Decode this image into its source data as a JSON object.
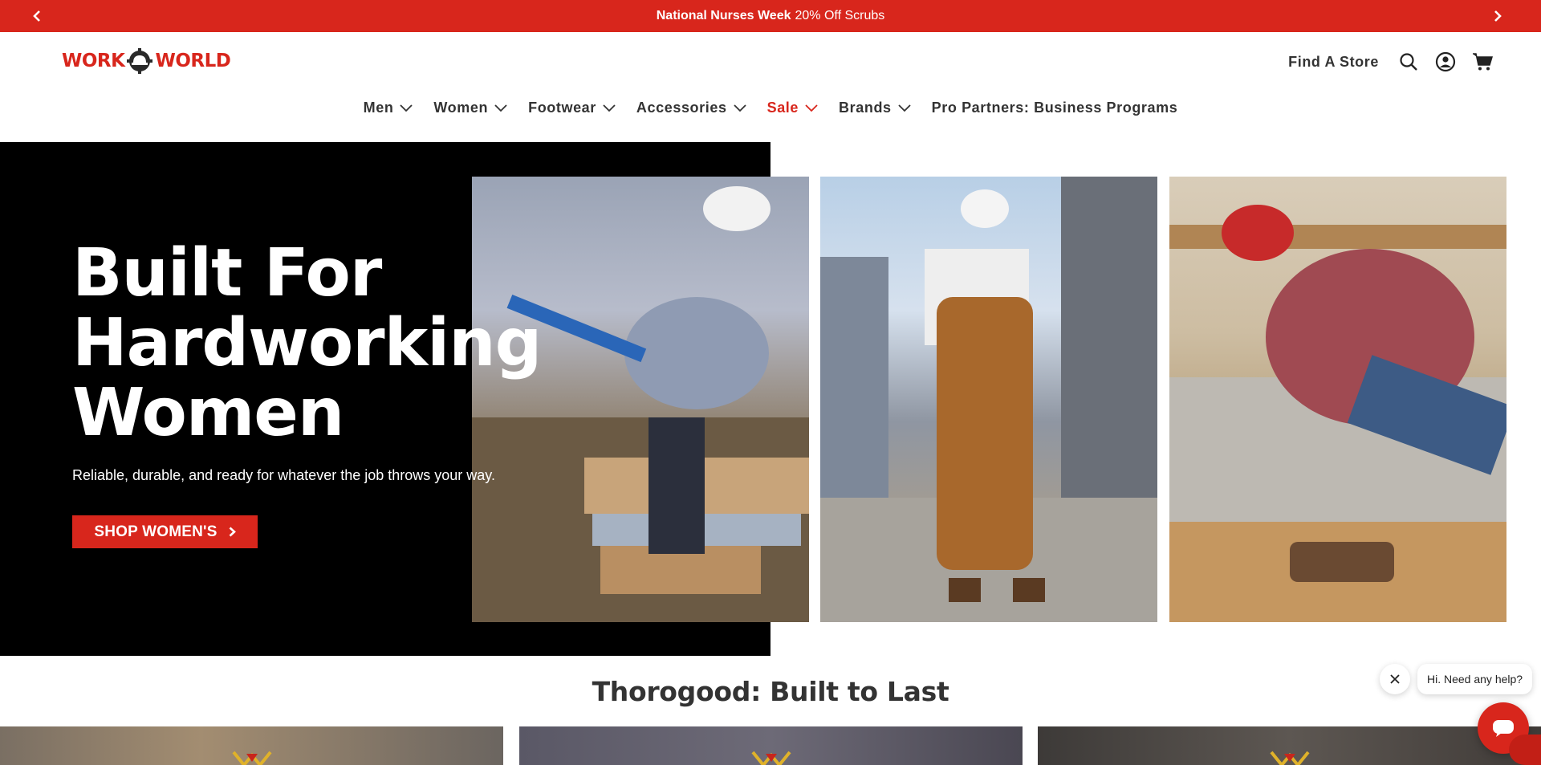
{
  "announcement": {
    "bold": "National Nurses Week",
    "text": "20% Off Scrubs",
    "prev_icon": "chevron-left-icon",
    "next_icon": "chevron-right-icon"
  },
  "brand": {
    "logo_left": "WORK",
    "logo_right": "WORLD",
    "color": "#d8261c"
  },
  "header": {
    "find_store": "Find A Store",
    "icons": [
      "search-icon",
      "account-icon",
      "cart-icon"
    ]
  },
  "nav": {
    "items": [
      {
        "label": "Men",
        "dropdown": true
      },
      {
        "label": "Women",
        "dropdown": true
      },
      {
        "label": "Footwear",
        "dropdown": true
      },
      {
        "label": "Accessories",
        "dropdown": true
      },
      {
        "label": "Sale",
        "dropdown": true,
        "color": "#d8261c"
      },
      {
        "label": "Brands",
        "dropdown": true
      },
      {
        "label": "Pro Partners: Business Programs",
        "dropdown": false
      }
    ]
  },
  "hero": {
    "title_lines": [
      "Built For",
      "Hardworking",
      "Women"
    ],
    "subtitle": "Reliable, durable, and ready for whatever the job throws your way.",
    "cta_label": "SHOP WOMEN'S",
    "cta_icon": "chevron-right-icon"
  },
  "section": {
    "title": "Thorogood: Built to Last"
  },
  "chat": {
    "prompt": "Hi. Need any help?",
    "close_icon": "close-icon",
    "open_icon": "chat-icon"
  }
}
